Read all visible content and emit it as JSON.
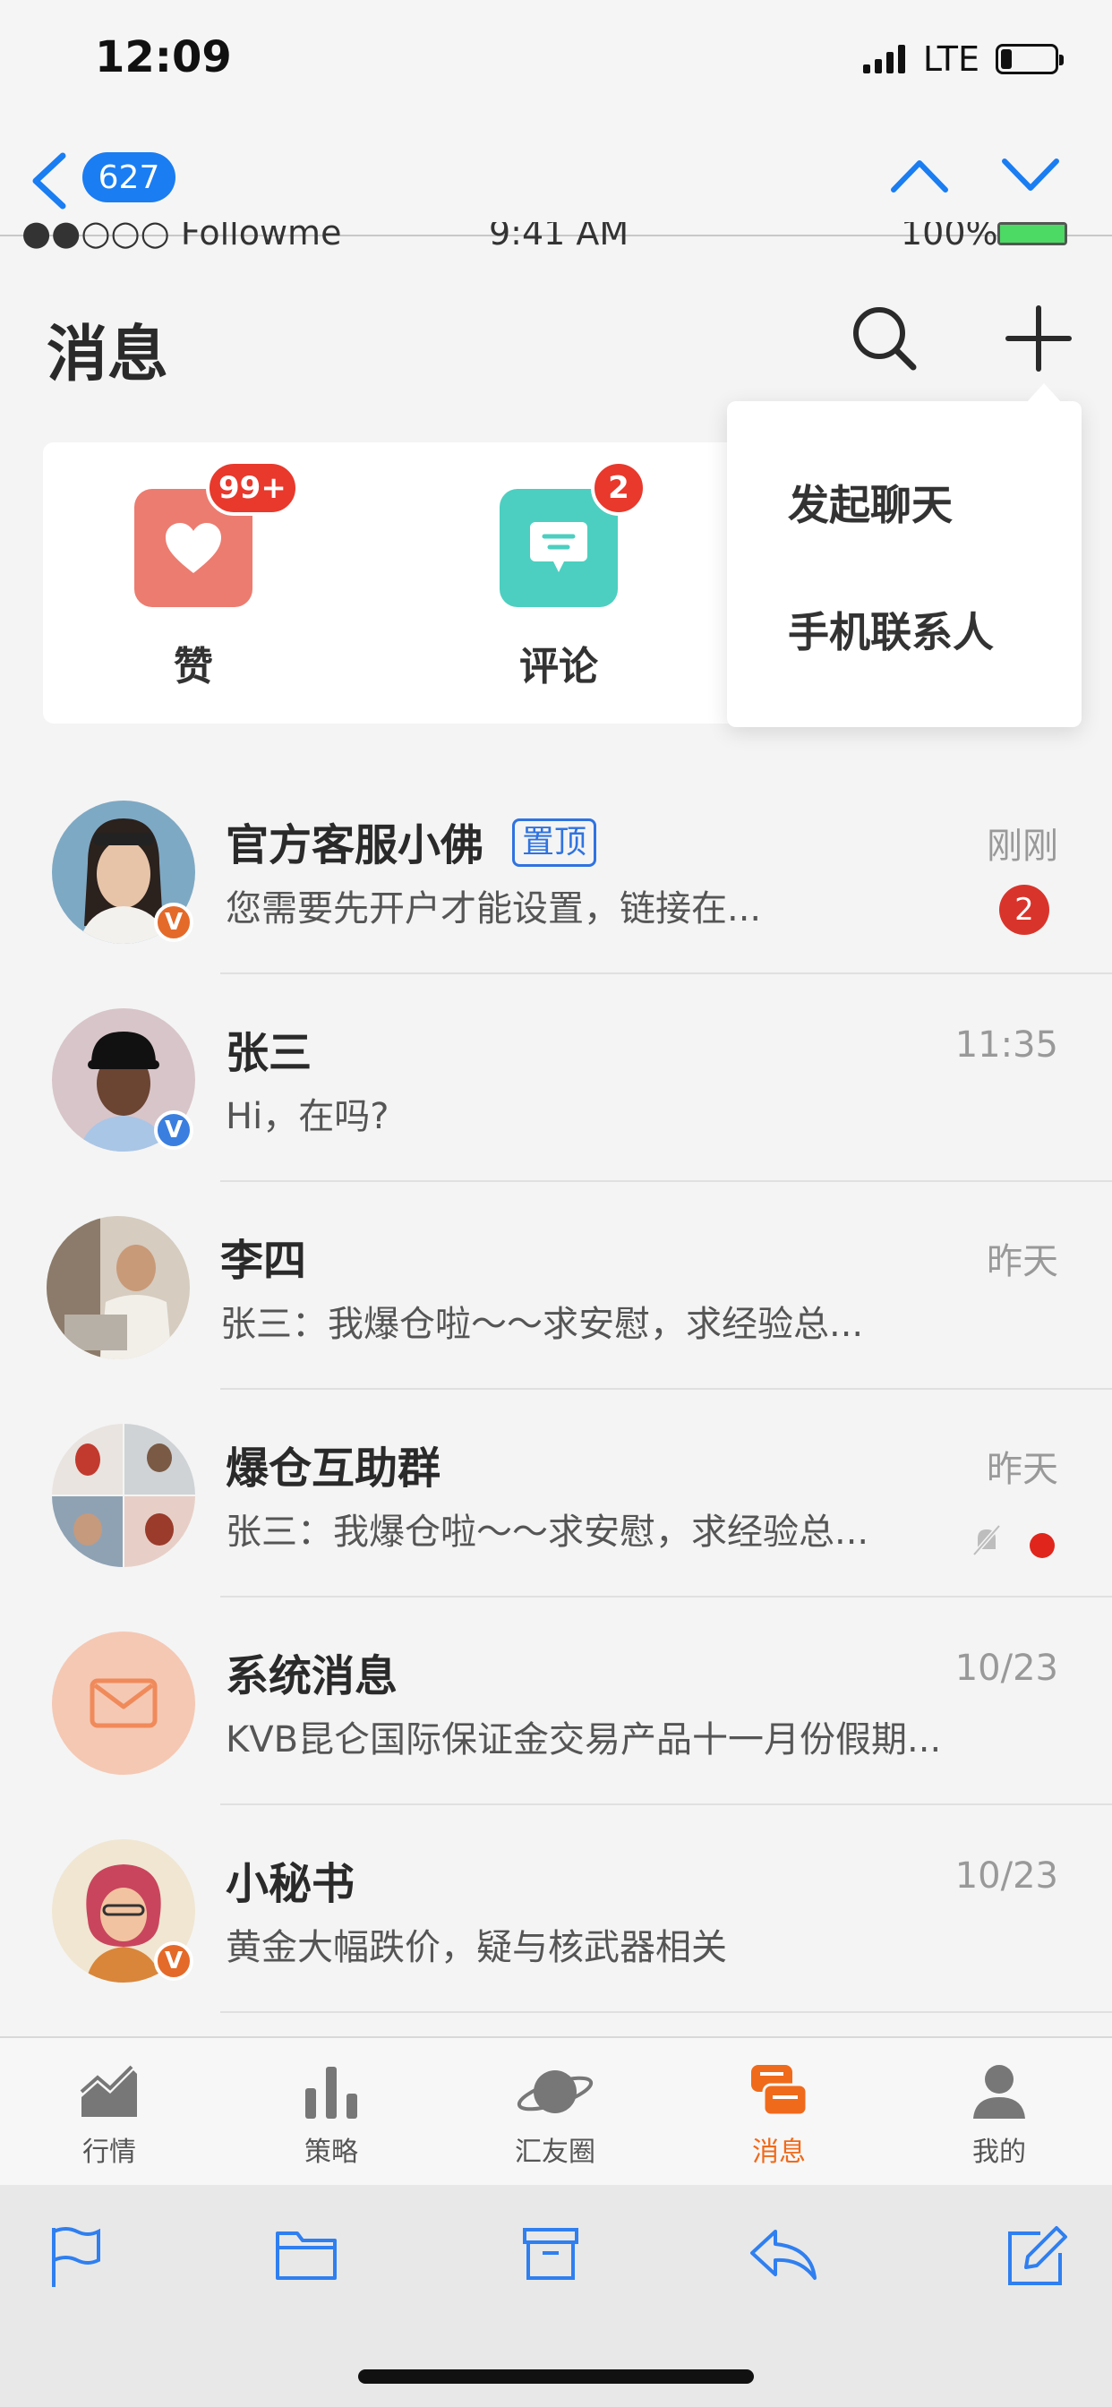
{
  "outer_status": {
    "time": "12:09",
    "network": "LTE"
  },
  "outer_nav": {
    "message_count": "627"
  },
  "inner_status": {
    "carrier": "●●○○○ Followme",
    "time": "9:41 AM",
    "battery": "100%"
  },
  "header": {
    "title": "消息"
  },
  "quick_actions": [
    {
      "label": "赞",
      "badge": "99+",
      "color": "#ec7c70"
    },
    {
      "label": "评论",
      "badge": "2",
      "color": "#4ccfc0"
    }
  ],
  "dropdown": {
    "items": [
      "发起聊天",
      "手机联系人"
    ]
  },
  "conversations": [
    {
      "name": "官方客服小佛",
      "tag": "置顶",
      "preview": "您需要先开户才能设置，链接在...",
      "time": "刚刚",
      "unread": "2",
      "verified": "V",
      "verified_color": "#e46a2a"
    },
    {
      "name": "张三",
      "preview": "Hi，在吗?",
      "time": "11:35",
      "verified": "V",
      "verified_color": "#3a7fe0"
    },
    {
      "name": "李四",
      "preview": "张三：我爆仓啦～～求安慰，求经验总...",
      "time": "昨天"
    },
    {
      "name": "爆仓互助群",
      "preview": "张三：我爆仓啦～～求安慰，求经验总...",
      "time": "昨天"
    },
    {
      "name": "系统消息",
      "preview": "KVB昆仑国际保证金交易产品十一月份假期...",
      "time": "10/23"
    },
    {
      "name": "小秘书",
      "preview": "黄金大幅跌价，疑与核武器相关",
      "time": "10/23",
      "verified": "V",
      "verified_color": "#e46a2a"
    }
  ],
  "tabs": [
    {
      "label": "行情",
      "icon": "chart-icon"
    },
    {
      "label": "策略",
      "icon": "bar-chart-icon"
    },
    {
      "label": "汇友圈",
      "icon": "planet-icon"
    },
    {
      "label": "消息",
      "icon": "message-icon",
      "active": true
    },
    {
      "label": "我的",
      "icon": "profile-icon"
    }
  ],
  "colors": {
    "accent_blue": "#1a7df2",
    "accent_orange": "#f06a1b",
    "badge_red": "#e8392c"
  }
}
